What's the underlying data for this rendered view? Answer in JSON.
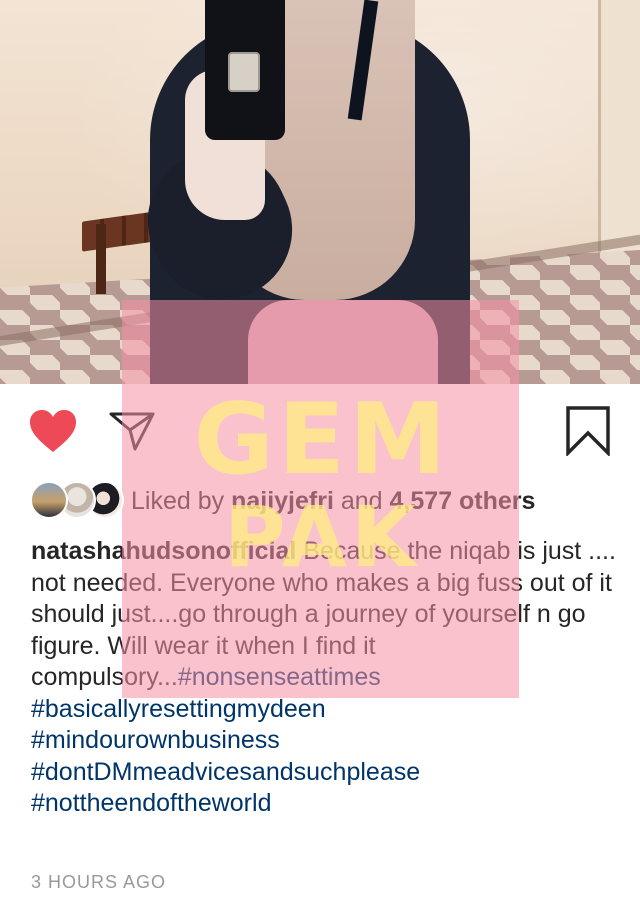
{
  "post": {
    "likes": {
      "prefix": "Liked by",
      "user": "najiyjefri",
      "joiner": "and",
      "count": "4,577 others"
    },
    "caption": {
      "username": "natashahudsonofficial",
      "text": "Because the niqab is just .... not needed. Everyone who makes a big fuss out of it should just....go through a journey of yourself n go figure. Will wear it when I find it compulsory...",
      "hashtags": [
        "#nonsenseattimes",
        "#basicallyresettingmydeen",
        "#mindourownbusiness",
        "#dontDMmeadvicesandsuchplease",
        "#nottheendoftheworld"
      ]
    },
    "timestamp": "3 HOURS AGO"
  },
  "icons": {
    "like": "heart-icon",
    "share": "send-icon",
    "save": "bookmark-icon"
  },
  "watermark": {
    "line1": "GEM",
    "line2": "PAK"
  },
  "colors": {
    "like_red": "#ed4956",
    "hashtag_blue": "#003569",
    "text": "#262626",
    "timestamp_gray": "#999999",
    "watermark_pink": "#f48fa4",
    "watermark_yellow": "#ffee82"
  }
}
